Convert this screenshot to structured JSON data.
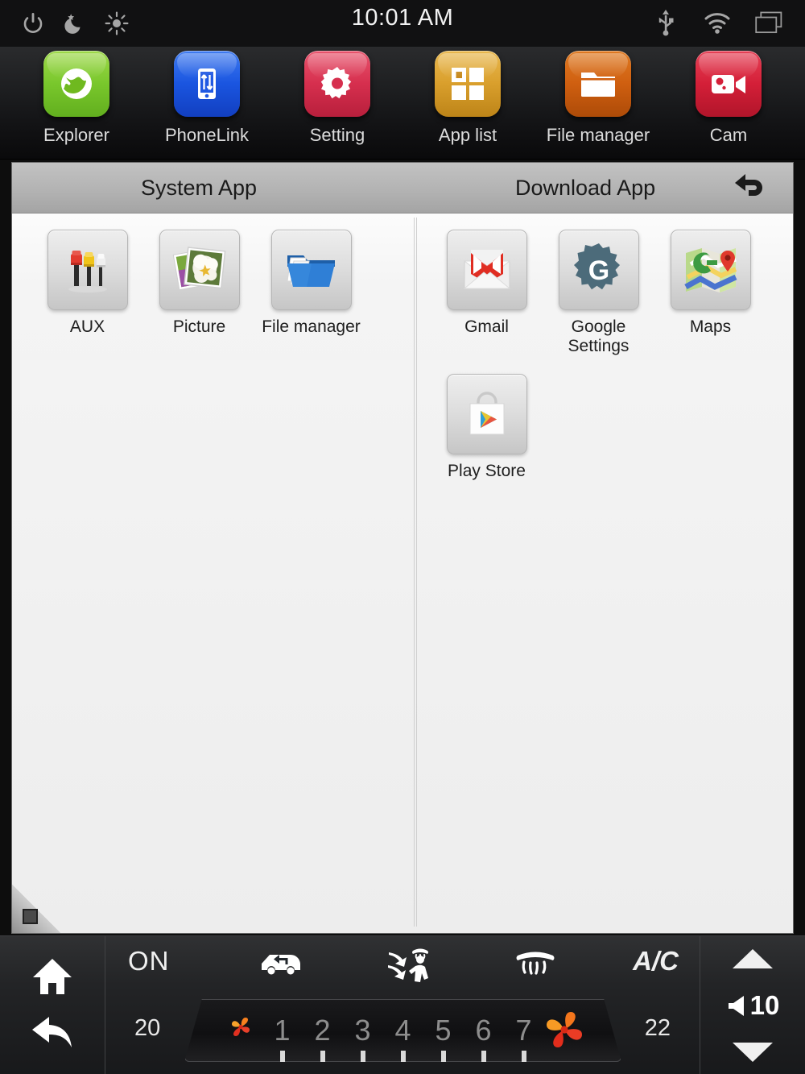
{
  "statusbar": {
    "clock": "10:01 AM",
    "left_icons": [
      {
        "name": "power-icon"
      },
      {
        "name": "night-mode-icon"
      },
      {
        "name": "brightness-icon"
      }
    ],
    "right_icons": [
      {
        "name": "usb-icon"
      },
      {
        "name": "wifi-icon"
      },
      {
        "name": "multi-window-icon"
      }
    ]
  },
  "toolbar": {
    "items": [
      {
        "label": "Explorer",
        "icon": "globe-icon",
        "color": "#79c72c"
      },
      {
        "label": "PhoneLink",
        "icon": "phonelink-icon",
        "color": "#1a55e0"
      },
      {
        "label": "Setting",
        "icon": "gear-icon",
        "color": "#d62f4e"
      },
      {
        "label": "App list",
        "icon": "grid-icon",
        "color": "#d99f2c"
      },
      {
        "label": "File manager",
        "icon": "folder-icon",
        "color": "#cf5f10"
      },
      {
        "label": "Cam",
        "icon": "video-camera-icon",
        "color": "#d41f38"
      }
    ]
  },
  "panel": {
    "system_header": "System App",
    "download_header": "Download App",
    "back_icon": "back-arrow-icon",
    "system_apps": [
      {
        "label": "AUX",
        "icon": "aux-rca-icon"
      },
      {
        "label": "Picture",
        "icon": "picture-gallery-icon"
      },
      {
        "label": "File manager",
        "icon": "blue-folder-icon"
      }
    ],
    "download_apps": [
      {
        "label": "Gmail",
        "icon": "gmail-icon"
      },
      {
        "label": "Google Settings",
        "icon": "google-settings-gear-icon"
      },
      {
        "label": "Maps",
        "icon": "google-maps-icon"
      },
      {
        "label": "Play Store",
        "icon": "play-store-icon"
      }
    ]
  },
  "climate": {
    "home_icon": "home-icon",
    "back_icon": "back-arrow-icon",
    "power_label": "ON",
    "ac_label": "A/C",
    "temp_left": "20",
    "temp_right": "22",
    "mode_icons": [
      {
        "name": "recirculation-icon"
      },
      {
        "name": "airflow-body-defrost-icon"
      },
      {
        "name": "rear-defrost-icon"
      }
    ],
    "fan_levels": [
      "1",
      "2",
      "3",
      "4",
      "5",
      "6",
      "7"
    ],
    "fan_down_icon": "fan-decrease-icon",
    "fan_up_icon": "fan-increase-icon",
    "volume_value": "10",
    "volume_up_icon": "triangle-up-icon",
    "volume_down_icon": "triangle-down-icon",
    "speaker_icon": "speaker-icon"
  }
}
